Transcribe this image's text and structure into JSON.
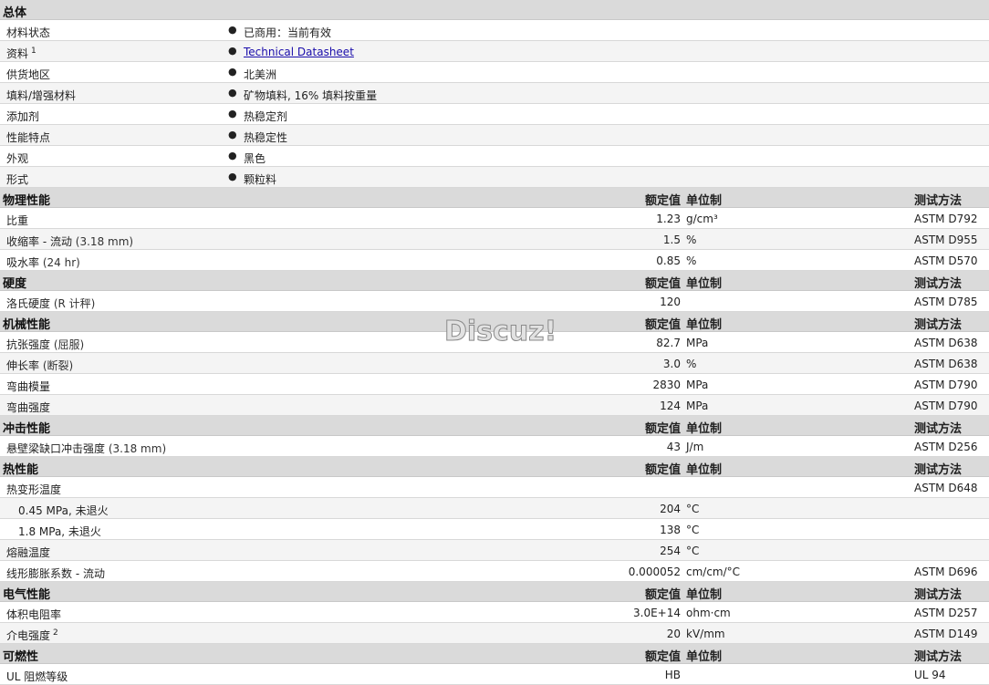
{
  "sections": [
    {
      "title": "总体",
      "rows": [
        {
          "label": "材料状态",
          "value": "已商用：当前有效"
        },
        {
          "label": "资料",
          "sup": "1",
          "value": "Technical Datasheet",
          "link": true
        },
        {
          "label": "供货地区",
          "value": "北美洲"
        },
        {
          "label": "填料/增强材料",
          "value": "矿物填料, 16% 填料按重量"
        },
        {
          "label": "添加剂",
          "value": "热稳定剂"
        },
        {
          "label": "性能特点",
          "value": "热稳定性"
        },
        {
          "label": "外观",
          "value": "黑色"
        },
        {
          "label": "形式",
          "value": "颗粒料"
        }
      ]
    },
    {
      "title": "物理性能",
      "nominal": "额定值",
      "unit": "单位制",
      "test": "测试方法",
      "rows": [
        {
          "label": "比重",
          "num": "1.23",
          "unit": "g/cm³",
          "test": "ASTM D792"
        },
        {
          "label": "收缩率 - 流动",
          "cond": "(3.18 mm)",
          "num": "1.5",
          "unit": "%",
          "test": "ASTM D955"
        },
        {
          "label": "吸水率",
          "cond": "(24 hr)",
          "num": "0.85",
          "unit": "%",
          "test": "ASTM D570"
        }
      ]
    },
    {
      "title": "硬度",
      "nominal": "额定值",
      "unit": "单位制",
      "test": "测试方法",
      "rows": [
        {
          "label": "洛氏硬度",
          "cond": "(R 计秤)",
          "num": "120",
          "unit": "",
          "test": "ASTM D785"
        }
      ]
    },
    {
      "title": "机械性能",
      "nominal": "额定值",
      "unit": "单位制",
      "test": "测试方法",
      "rows": [
        {
          "label": "抗张强度",
          "cond": "(屈服)",
          "num": "82.7",
          "unit": "MPa",
          "test": "ASTM D638"
        },
        {
          "label": "伸长率",
          "cond": "(断裂)",
          "num": "3.0",
          "unit": "%",
          "test": "ASTM D638"
        },
        {
          "label": "弯曲模量",
          "num": "2830",
          "unit": "MPa",
          "test": "ASTM D790"
        },
        {
          "label": "弯曲强度",
          "num": "124",
          "unit": "MPa",
          "test": "ASTM D790"
        }
      ]
    },
    {
      "title": "冲击性能",
      "nominal": "额定值",
      "unit": "单位制",
      "test": "测试方法",
      "rows": [
        {
          "label": "悬壁梁缺口冲击强度",
          "cond": "(3.18 mm)",
          "num": "43",
          "unit": "J/m",
          "test": "ASTM D256"
        }
      ]
    },
    {
      "title": "热性能",
      "nominal": "额定值",
      "unit": "单位制",
      "test": "测试方法",
      "rows": [
        {
          "label": "热变形温度",
          "num": "",
          "unit": "",
          "test": "ASTM D648"
        },
        {
          "label": "0.45 MPa, 未退火",
          "sub": true,
          "num": "204",
          "unit": "°C",
          "test": ""
        },
        {
          "label": "1.8 MPa, 未退火",
          "sub": true,
          "num": "138",
          "unit": "°C",
          "test": ""
        },
        {
          "label": "熔融温度",
          "num": "254",
          "unit": "°C",
          "test": ""
        },
        {
          "label": "线形膨胀系数 - 流动",
          "num": "0.000052",
          "unit": "cm/cm/°C",
          "test": "ASTM D696"
        }
      ]
    },
    {
      "title": "电气性能",
      "nominal": "额定值",
      "unit": "单位制",
      "test": "测试方法",
      "rows": [
        {
          "label": "体积电阻率",
          "num": "3.0E+14",
          "unit": "ohm·cm",
          "test": "ASTM D257"
        },
        {
          "label": "介电强度",
          "sup": "2",
          "num": "20",
          "unit": "kV/mm",
          "test": "ASTM D149"
        }
      ]
    },
    {
      "title": "可燃性",
      "nominal": "额定值",
      "unit": "单位制",
      "test": "测试方法",
      "rows": [
        {
          "label": "UL 阻燃等级",
          "num": "HB",
          "unit": "",
          "test": "UL 94"
        }
      ]
    }
  ],
  "watermark": "Discuz!"
}
